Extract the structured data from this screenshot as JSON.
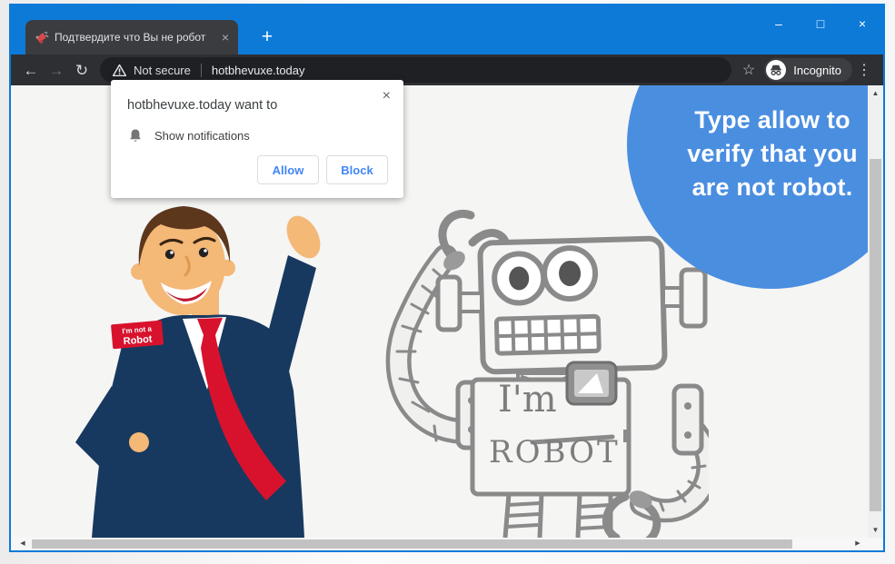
{
  "window_controls": {
    "minimize": "–",
    "maximize": "□",
    "close": "×"
  },
  "tab": {
    "title": "Подтвердите что Вы не робот",
    "close_glyph": "×",
    "new_tab_glyph": "+"
  },
  "toolbar": {
    "not_secure_label": "Not secure",
    "url": "hotbhevuxe.today",
    "incognito_label": "Incognito"
  },
  "icons": {
    "back": "←",
    "forward": "→",
    "reload": "↻",
    "star": "☆",
    "menu_dots": "⋮",
    "scroll_up": "▲",
    "scroll_down": "▼",
    "scroll_left": "◀",
    "scroll_right": "▶"
  },
  "dialog": {
    "title": "hotbhevuxe.today want to",
    "permission": "Show notifications",
    "allow_label": "Allow",
    "block_label": "Block",
    "close_glyph": "×"
  },
  "content": {
    "bubble": {
      "line1": "Type allow to",
      "line2": "verify that you",
      "line3": "are not robot."
    },
    "badge": {
      "line1": "I'm not a",
      "line2": "Robot"
    },
    "robot_label": {
      "line1": "I'm",
      "line2": "ROBOT"
    }
  },
  "colors": {
    "titlebar_blue": "#0d7ad8",
    "toolbar_dark": "#2e2f33",
    "tab_dark": "#3b3c40",
    "addressbar_dark": "#1f2023",
    "page_bg": "#f5f5f4",
    "bubble_blue": "#4a8ee0",
    "button_blue": "#4285f4",
    "suit_navy": "#17395f",
    "tie_red": "#d8122d",
    "skin": "#f4b877",
    "hair_brown": "#5d371c",
    "sketch_gray": "#8a8a8a"
  }
}
